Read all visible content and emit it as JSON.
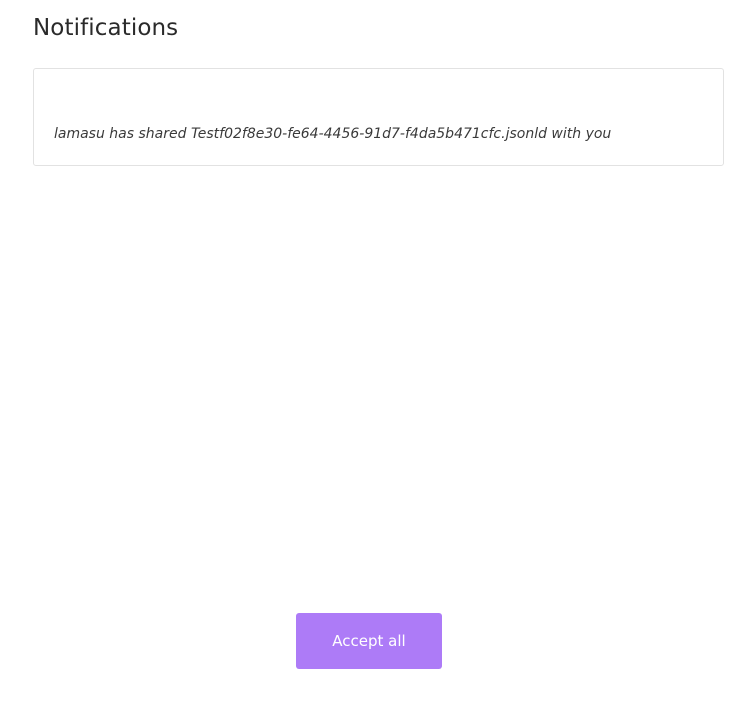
{
  "page": {
    "title": "Notifications"
  },
  "notifications": [
    {
      "text": "lamasu has shared Testf02f8e30-fe64-4456-91d7-f4da5b471cfc.jsonld with you"
    }
  ],
  "actions": {
    "accept_all_label": "Accept all"
  },
  "colors": {
    "accent": "#ad7bf7",
    "panel_border": "#e2e2e2"
  }
}
